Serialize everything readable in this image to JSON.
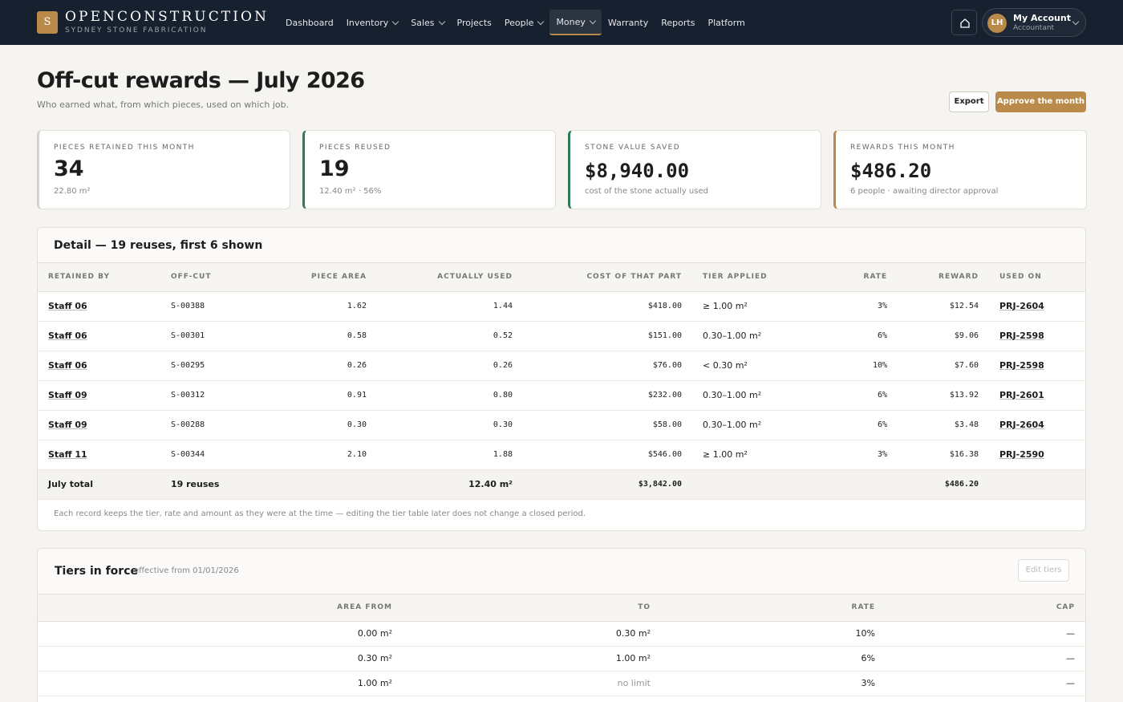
{
  "brand": {
    "logo_letter": "S",
    "name": "OPENCONSTRUCTION",
    "subtitle": "SYDNEY STONE FABRICATION"
  },
  "nav": [
    {
      "label": "Dashboard",
      "has_menu": false
    },
    {
      "label": "Inventory",
      "has_menu": true
    },
    {
      "label": "Sales",
      "has_menu": true
    },
    {
      "label": "Projects",
      "has_menu": false
    },
    {
      "label": "People",
      "has_menu": true
    },
    {
      "label": "Money",
      "has_menu": true,
      "active": true
    },
    {
      "label": "Warranty",
      "has_menu": false
    },
    {
      "label": "Reports",
      "has_menu": false
    },
    {
      "label": "Platform",
      "has_menu": false
    }
  ],
  "account": {
    "initials": "LH",
    "name": "My Account",
    "role": "Accountant"
  },
  "header": {
    "title": "Off-cut rewards — July 2026",
    "subtitle": "Who earned what, from which pieces, used on which job.",
    "export_label": "Export",
    "approve_label": "Approve the month"
  },
  "kpis": [
    {
      "label": "PIECES RETAINED THIS MONTH",
      "value": "34",
      "note": "22.80 m²"
    },
    {
      "label": "PIECES REUSED",
      "value": "19",
      "note": "12.40 m² · 56%"
    },
    {
      "label": "STONE VALUE SAVED",
      "value": "$8,940.00",
      "note": "cost of the stone actually used"
    },
    {
      "label": "REWARDS THIS MONTH",
      "value": "$486.20",
      "note": "6 people · awaiting director approval"
    }
  ],
  "detail": {
    "title": "Detail — 19 reuses, first 6 shown",
    "columns": [
      "RETAINED BY",
      "OFF-CUT",
      "PIECE AREA",
      "ACTUALLY USED",
      "COST OF THAT PART",
      "TIER APPLIED",
      "RATE",
      "REWARD",
      "USED ON"
    ],
    "rows": [
      {
        "staff": "Staff 06",
        "offcut": "S-00388",
        "area": "1.62",
        "used": "1.44",
        "cost": "$418.00",
        "tier": "≥ 1.00 m²",
        "rate": "3%",
        "reward": "$12.54",
        "job": "PRJ-2604"
      },
      {
        "staff": "Staff 06",
        "offcut": "S-00301",
        "area": "0.58",
        "used": "0.52",
        "cost": "$151.00",
        "tier": "0.30–1.00 m²",
        "rate": "6%",
        "reward": "$9.06",
        "job": "PRJ-2598"
      },
      {
        "staff": "Staff 06",
        "offcut": "S-00295",
        "area": "0.26",
        "used": "0.26",
        "cost": "$76.00",
        "tier": "< 0.30 m²",
        "rate": "10%",
        "reward": "$7.60",
        "job": "PRJ-2598"
      },
      {
        "staff": "Staff 09",
        "offcut": "S-00312",
        "area": "0.91",
        "used": "0.80",
        "cost": "$232.00",
        "tier": "0.30–1.00 m²",
        "rate": "6%",
        "reward": "$13.92",
        "job": "PRJ-2601"
      },
      {
        "staff": "Staff 09",
        "offcut": "S-00288",
        "area": "0.30",
        "used": "0.30",
        "cost": "$58.00",
        "tier": "0.30–1.00 m²",
        "rate": "6%",
        "reward": "$3.48",
        "job": "PRJ-2604"
      },
      {
        "staff": "Staff 11",
        "offcut": "S-00344",
        "area": "2.10",
        "used": "1.88",
        "cost": "$546.00",
        "tier": "≥ 1.00 m²",
        "rate": "3%",
        "reward": "$16.38",
        "job": "PRJ-2590"
      }
    ],
    "total": {
      "label": "July total",
      "count": "19 reuses",
      "used": "12.40 m²",
      "cost": "$3,842.00",
      "reward": "$486.20"
    },
    "note": "Each record keeps the tier, rate and amount as they were at the time — editing the tier table later does not change a closed period."
  },
  "tiers": {
    "title": "Tiers in force",
    "effective": "effective from 01/01/2026",
    "edit_label": "Edit tiers",
    "columns": [
      "AREA FROM",
      "TO",
      "RATE",
      "CAP"
    ],
    "rows": [
      {
        "from": "0.00 m²",
        "to": "0.30 m²",
        "rate": "10%",
        "cap": "—",
        "to_muted": false
      },
      {
        "from": "0.30 m²",
        "to": "1.00 m²",
        "rate": "6%",
        "cap": "—",
        "to_muted": false
      },
      {
        "from": "1.00 m²",
        "to": "no limit",
        "rate": "3%",
        "cap": "—",
        "to_muted": true
      }
    ]
  }
}
